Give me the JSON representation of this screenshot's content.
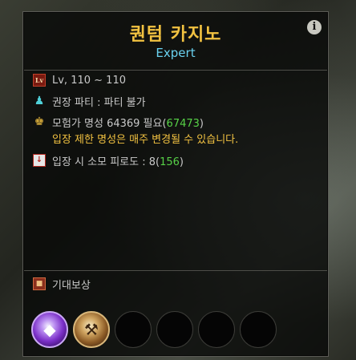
{
  "dungeon": {
    "title": "퀀텀 카지노",
    "difficulty": "Expert"
  },
  "info": {
    "level": "Lv, 110 ~ 110",
    "party": "권장 파티 : 파티 불가",
    "fame_label": "모험가 명성 64369 필요(",
    "fame_current": "67473",
    "fame_close": ")",
    "fame_note": "입장 제한 명성은 매주 변경될 수 있습니다.",
    "fatigue_label": "입장 시 소모 피로도 : 8(",
    "fatigue_current": "156",
    "fatigue_close": ")"
  },
  "rewards": {
    "header": "기대보상"
  },
  "icons": {
    "info": "i",
    "level": "Lv",
    "party": "party-icon",
    "fame": "fame-icon",
    "fatigue": "fatigue-icon",
    "reward": "reward-chest-icon"
  },
  "colors": {
    "title": "#f2c241",
    "subtitle": "#6ad2f0",
    "highlight_green": "#57d247",
    "warning_yellow": "#f2c241"
  }
}
